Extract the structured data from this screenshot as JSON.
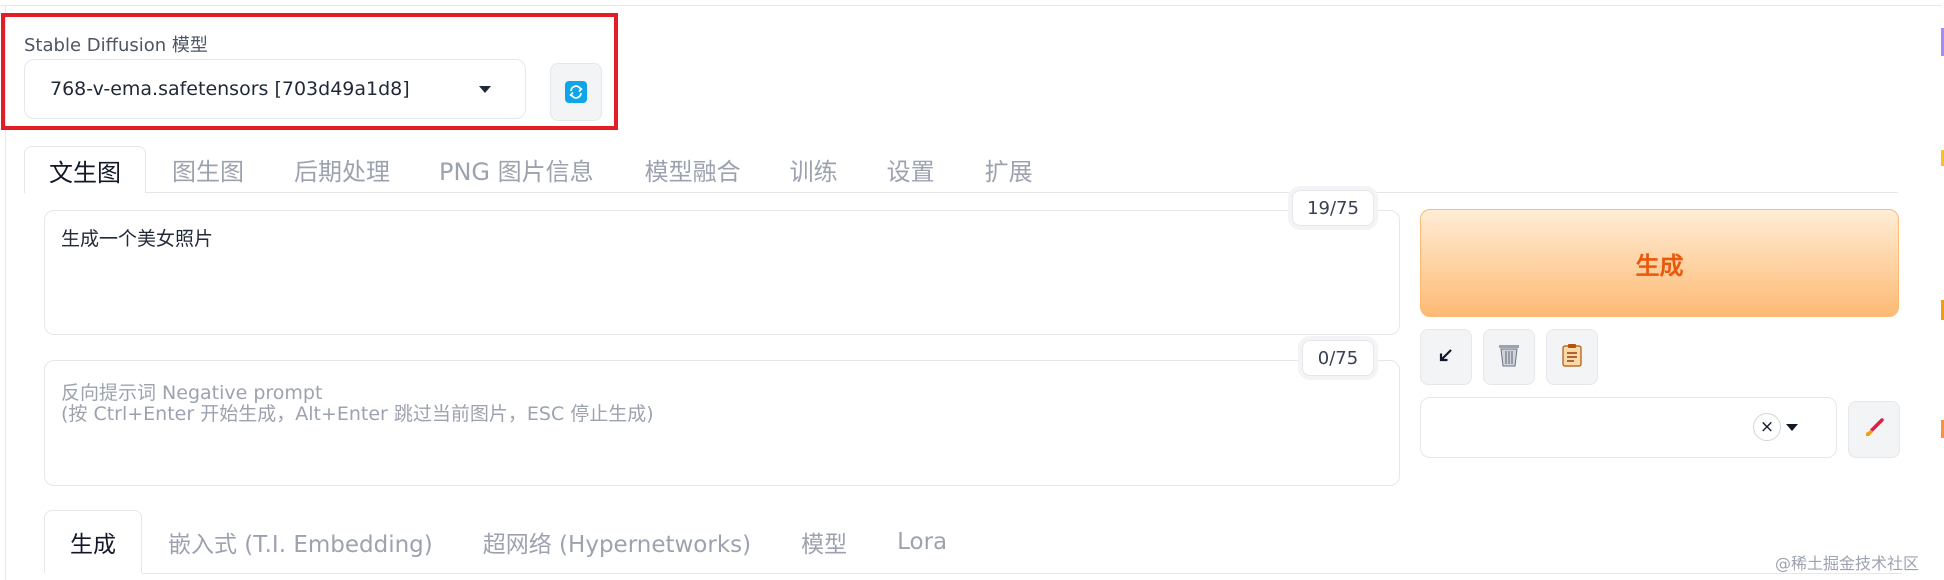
{
  "model": {
    "label": "Stable Diffusion 模型",
    "selected": "768-v-ema.safetensors [703d49a1d8]",
    "refresh_icon": "refresh-icon"
  },
  "tabs": [
    {
      "label": "文生图",
      "active": true
    },
    {
      "label": "图生图"
    },
    {
      "label": "后期处理"
    },
    {
      "label": "PNG 图片信息"
    },
    {
      "label": "模型融合"
    },
    {
      "label": "训练"
    },
    {
      "label": "设置"
    },
    {
      "label": "扩展"
    }
  ],
  "prompt": {
    "value": "生成一个美女照片",
    "token_count": "19/75"
  },
  "negative_prompt": {
    "placeholder_line1": "反向提示词 Negative prompt",
    "placeholder_line2": "(按 Ctrl+Enter 开始生成，Alt+Enter 跳过当前图片，ESC 停止生成)",
    "token_count": "0/75"
  },
  "actions": {
    "generate_label": "生成",
    "icons": [
      "arrow-down-left-icon",
      "trash-icon",
      "clipboard-icon"
    ],
    "style_clear": "×",
    "style_icon": "paint-brush-icon"
  },
  "subtabs": [
    {
      "label": "生成",
      "active": true
    },
    {
      "label": "嵌入式 (T.I. Embedding)"
    },
    {
      "label": "超网络 (Hypernetworks)"
    },
    {
      "label": "模型"
    },
    {
      "label": "Lora"
    }
  ],
  "watermark": "@稀土掘金技术社区",
  "colors": {
    "accent_orange": "#ea580c",
    "highlight_red": "#e11d26",
    "refresh_blue": "#0ea5e9"
  }
}
